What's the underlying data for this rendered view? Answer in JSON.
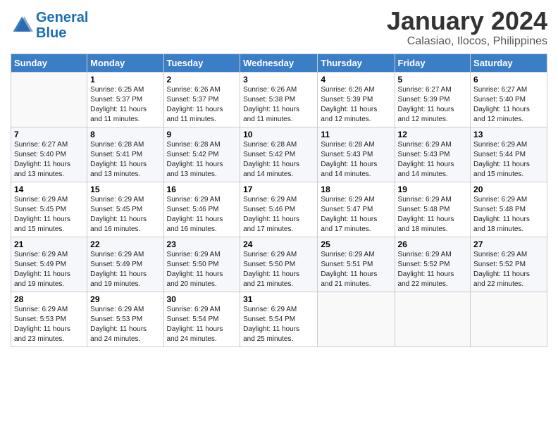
{
  "header": {
    "logo_line1": "General",
    "logo_line2": "Blue",
    "month": "January 2024",
    "location": "Calasiao, Ilocos, Philippines"
  },
  "days_of_week": [
    "Sunday",
    "Monday",
    "Tuesday",
    "Wednesday",
    "Thursday",
    "Friday",
    "Saturday"
  ],
  "weeks": [
    [
      {
        "num": "",
        "info": ""
      },
      {
        "num": "1",
        "info": "Sunrise: 6:25 AM\nSunset: 5:37 PM\nDaylight: 11 hours\nand 11 minutes."
      },
      {
        "num": "2",
        "info": "Sunrise: 6:26 AM\nSunset: 5:37 PM\nDaylight: 11 hours\nand 11 minutes."
      },
      {
        "num": "3",
        "info": "Sunrise: 6:26 AM\nSunset: 5:38 PM\nDaylight: 11 hours\nand 11 minutes."
      },
      {
        "num": "4",
        "info": "Sunrise: 6:26 AM\nSunset: 5:39 PM\nDaylight: 11 hours\nand 12 minutes."
      },
      {
        "num": "5",
        "info": "Sunrise: 6:27 AM\nSunset: 5:39 PM\nDaylight: 11 hours\nand 12 minutes."
      },
      {
        "num": "6",
        "info": "Sunrise: 6:27 AM\nSunset: 5:40 PM\nDaylight: 11 hours\nand 12 minutes."
      }
    ],
    [
      {
        "num": "7",
        "info": "Sunrise: 6:27 AM\nSunset: 5:40 PM\nDaylight: 11 hours\nand 13 minutes."
      },
      {
        "num": "8",
        "info": "Sunrise: 6:28 AM\nSunset: 5:41 PM\nDaylight: 11 hours\nand 13 minutes."
      },
      {
        "num": "9",
        "info": "Sunrise: 6:28 AM\nSunset: 5:42 PM\nDaylight: 11 hours\nand 13 minutes."
      },
      {
        "num": "10",
        "info": "Sunrise: 6:28 AM\nSunset: 5:42 PM\nDaylight: 11 hours\nand 14 minutes."
      },
      {
        "num": "11",
        "info": "Sunrise: 6:28 AM\nSunset: 5:43 PM\nDaylight: 11 hours\nand 14 minutes."
      },
      {
        "num": "12",
        "info": "Sunrise: 6:29 AM\nSunset: 5:43 PM\nDaylight: 11 hours\nand 14 minutes."
      },
      {
        "num": "13",
        "info": "Sunrise: 6:29 AM\nSunset: 5:44 PM\nDaylight: 11 hours\nand 15 minutes."
      }
    ],
    [
      {
        "num": "14",
        "info": "Sunrise: 6:29 AM\nSunset: 5:45 PM\nDaylight: 11 hours\nand 15 minutes."
      },
      {
        "num": "15",
        "info": "Sunrise: 6:29 AM\nSunset: 5:45 PM\nDaylight: 11 hours\nand 16 minutes."
      },
      {
        "num": "16",
        "info": "Sunrise: 6:29 AM\nSunset: 5:46 PM\nDaylight: 11 hours\nand 16 minutes."
      },
      {
        "num": "17",
        "info": "Sunrise: 6:29 AM\nSunset: 5:46 PM\nDaylight: 11 hours\nand 17 minutes."
      },
      {
        "num": "18",
        "info": "Sunrise: 6:29 AM\nSunset: 5:47 PM\nDaylight: 11 hours\nand 17 minutes."
      },
      {
        "num": "19",
        "info": "Sunrise: 6:29 AM\nSunset: 5:48 PM\nDaylight: 11 hours\nand 18 minutes."
      },
      {
        "num": "20",
        "info": "Sunrise: 6:29 AM\nSunset: 5:48 PM\nDaylight: 11 hours\nand 18 minutes."
      }
    ],
    [
      {
        "num": "21",
        "info": "Sunrise: 6:29 AM\nSunset: 5:49 PM\nDaylight: 11 hours\nand 19 minutes."
      },
      {
        "num": "22",
        "info": "Sunrise: 6:29 AM\nSunset: 5:49 PM\nDaylight: 11 hours\nand 19 minutes."
      },
      {
        "num": "23",
        "info": "Sunrise: 6:29 AM\nSunset: 5:50 PM\nDaylight: 11 hours\nand 20 minutes."
      },
      {
        "num": "24",
        "info": "Sunrise: 6:29 AM\nSunset: 5:50 PM\nDaylight: 11 hours\nand 21 minutes."
      },
      {
        "num": "25",
        "info": "Sunrise: 6:29 AM\nSunset: 5:51 PM\nDaylight: 11 hours\nand 21 minutes."
      },
      {
        "num": "26",
        "info": "Sunrise: 6:29 AM\nSunset: 5:52 PM\nDaylight: 11 hours\nand 22 minutes."
      },
      {
        "num": "27",
        "info": "Sunrise: 6:29 AM\nSunset: 5:52 PM\nDaylight: 11 hours\nand 22 minutes."
      }
    ],
    [
      {
        "num": "28",
        "info": "Sunrise: 6:29 AM\nSunset: 5:53 PM\nDaylight: 11 hours\nand 23 minutes."
      },
      {
        "num": "29",
        "info": "Sunrise: 6:29 AM\nSunset: 5:53 PM\nDaylight: 11 hours\nand 24 minutes."
      },
      {
        "num": "30",
        "info": "Sunrise: 6:29 AM\nSunset: 5:54 PM\nDaylight: 11 hours\nand 24 minutes."
      },
      {
        "num": "31",
        "info": "Sunrise: 6:29 AM\nSunset: 5:54 PM\nDaylight: 11 hours\nand 25 minutes."
      },
      {
        "num": "",
        "info": ""
      },
      {
        "num": "",
        "info": ""
      },
      {
        "num": "",
        "info": ""
      }
    ]
  ]
}
